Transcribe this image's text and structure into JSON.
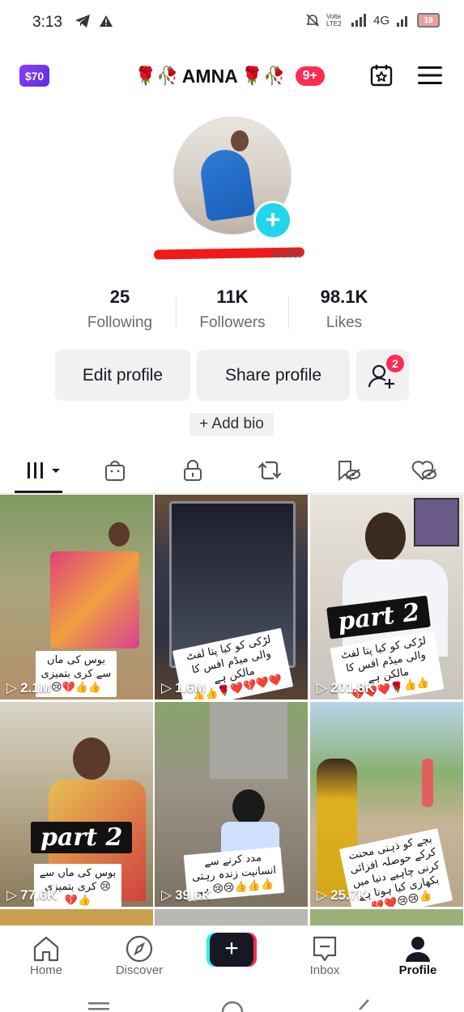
{
  "status_bar": {
    "time": "3:13",
    "network": "4G",
    "battery": "19",
    "lte": "Volte LTE2"
  },
  "header": {
    "coin_label": "$70",
    "title": "AMNA",
    "title_emoji": "🌹🥀",
    "notifications_badge": "9+",
    "calendar_icon": "calendar-star-icon",
    "menu_icon": "hamburger-menu-icon"
  },
  "profile": {
    "username_visible_tail": "ester",
    "stats": [
      {
        "value": "25",
        "label": "Following"
      },
      {
        "value": "11K",
        "label": "Followers"
      },
      {
        "value": "98.1K",
        "label": "Likes"
      }
    ],
    "edit_button": "Edit profile",
    "share_button": "Share profile",
    "friend_requests_badge": "2",
    "bio_button": "+ Add bio"
  },
  "tabs": [
    {
      "icon": "grid-videos-icon",
      "active": true
    },
    {
      "icon": "shop-bag-icon"
    },
    {
      "icon": "private-lock-icon"
    },
    {
      "icon": "repost-icon"
    },
    {
      "icon": "favorites-hidden-icon"
    },
    {
      "icon": "liked-hidden-icon"
    }
  ],
  "videos": [
    {
      "views": "2.1M",
      "caption": "بوس کی ماں سے کری بتمیزی 😢💔👍👍"
    },
    {
      "views": "1.6M",
      "caption": "لڑکی کو کیا پتا لفٹ والی میڈم افس کا مالکن ہے",
      "caption_emoji": "👍👍🌹❤️💔❤️❤️"
    },
    {
      "views": "201.8K",
      "badge": "part 2",
      "caption": "لڑکی کو کیا پتا لفٹ والی میڈم افس کا مالکن ہے",
      "caption_emoji": "💔❤️❤️🌹👍👍"
    },
    {
      "views": "77.6K",
      "badge": "part 2",
      "caption": "بوس کی ماں سے کری بتمیزی 😢💔👍"
    },
    {
      "views": "39.6K",
      "caption": "مدد کرنے سے انسانیت زندہ رہتی ہے 😢😢👍👍👍"
    },
    {
      "views": "25.7K",
      "caption": "بچے کو ذہنی محنت کرکے حوصلہ افزائی کرنی چاہیے دنیا میں بکھاری کیا ہوتا ہے",
      "caption_emoji": "💔❤️😢😢👍"
    }
  ],
  "bottom_nav": [
    {
      "label": "Home",
      "icon": "home-icon"
    },
    {
      "label": "Discover",
      "icon": "compass-icon"
    },
    {
      "label": "",
      "icon": "create-plus-icon"
    },
    {
      "label": "Inbox",
      "icon": "inbox-icon"
    },
    {
      "label": "Profile",
      "icon": "profile-icon",
      "active": true
    }
  ]
}
